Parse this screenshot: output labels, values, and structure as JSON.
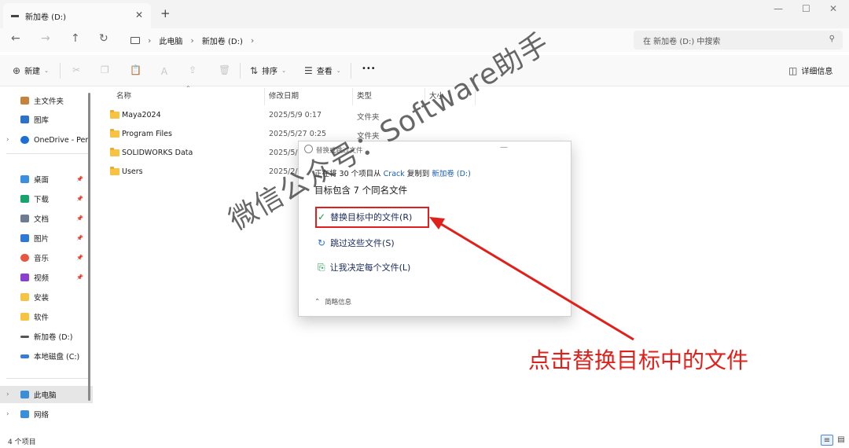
{
  "window": {
    "tab_title": "新加卷 (D:)",
    "new_tab": "+",
    "close_tab": "✕",
    "minimize": "—",
    "maximize": "☐",
    "close": "✕"
  },
  "address": {
    "crumbs": [
      "此电脑",
      "新加卷 (D:)"
    ],
    "search_placeholder": "在 新加卷 (D:) 中搜索"
  },
  "toolbar": {
    "new_label": "新建",
    "sort_label": "排序",
    "view_label": "查看",
    "more_label": "•••",
    "details_label": "详细信息"
  },
  "sidebar": {
    "items": [
      {
        "label": "主文件夹",
        "icon": "home-icon",
        "color": "#c4843b"
      },
      {
        "label": "图库",
        "icon": "gallery-icon",
        "color": "#2b73c9"
      },
      {
        "label": "OneDrive - Per",
        "icon": "cloud-icon",
        "color": "#1d6fd6"
      },
      {
        "label": "桌面",
        "icon": "desktop-icon",
        "color": "#3b8fe0"
      },
      {
        "label": "下载",
        "icon": "download-icon",
        "color": "#16a36c"
      },
      {
        "label": "文档",
        "icon": "documents-icon",
        "color": "#6b7c93"
      },
      {
        "label": "图片",
        "icon": "pictures-icon",
        "color": "#2d7ad6"
      },
      {
        "label": "音乐",
        "icon": "music-icon",
        "color": "#e8563f"
      },
      {
        "label": "视频",
        "icon": "video-icon",
        "color": "#8a3fd1"
      },
      {
        "label": "安装",
        "icon": "folder-icon",
        "color": "#f6c343"
      },
      {
        "label": "软件",
        "icon": "folder-icon",
        "color": "#f6c343"
      },
      {
        "label": "新加卷 (D:)",
        "icon": "drive-icon",
        "color": "#555555"
      },
      {
        "label": "本地磁盘 (C:)",
        "icon": "drive-icon",
        "color": "#3a7bd5"
      },
      {
        "label": "此电脑",
        "icon": "computer-icon",
        "color": "#3a8fd8"
      },
      {
        "label": "网络",
        "icon": "network-icon",
        "color": "#3a8fd8"
      }
    ]
  },
  "files": {
    "columns": [
      "名称",
      "修改日期",
      "类型",
      "大小"
    ],
    "rows": [
      {
        "name": "Maya2024",
        "date": "2025/5/9 0:17",
        "type": "文件夹"
      },
      {
        "name": "Program Files",
        "date": "2025/5/27 0:25",
        "type": "文件夹"
      },
      {
        "name": "SOLIDWORKS Data",
        "date": "2025/5/",
        "type": ""
      },
      {
        "name": "Users",
        "date": "2025/2/",
        "type": ""
      }
    ]
  },
  "status": {
    "count": "4 个项目"
  },
  "dialog": {
    "title": "替换或跳过文件",
    "line_prefix": "正在将 30 个项目从",
    "source": "Crack",
    "line_mid": "复制到",
    "dest": "新加卷 (D:)",
    "heading": "目标包含 7 个同名文件",
    "opt_replace": "替换目标中的文件(R)",
    "opt_skip": "跳过这些文件(S)",
    "opt_decide": "让我决定每个文件(L)",
    "footer": "简略信息"
  },
  "overlay": {
    "watermark": "微信公众号：Software助手",
    "callout": "点击替换目标中的文件",
    "accent": "#e0201a"
  }
}
